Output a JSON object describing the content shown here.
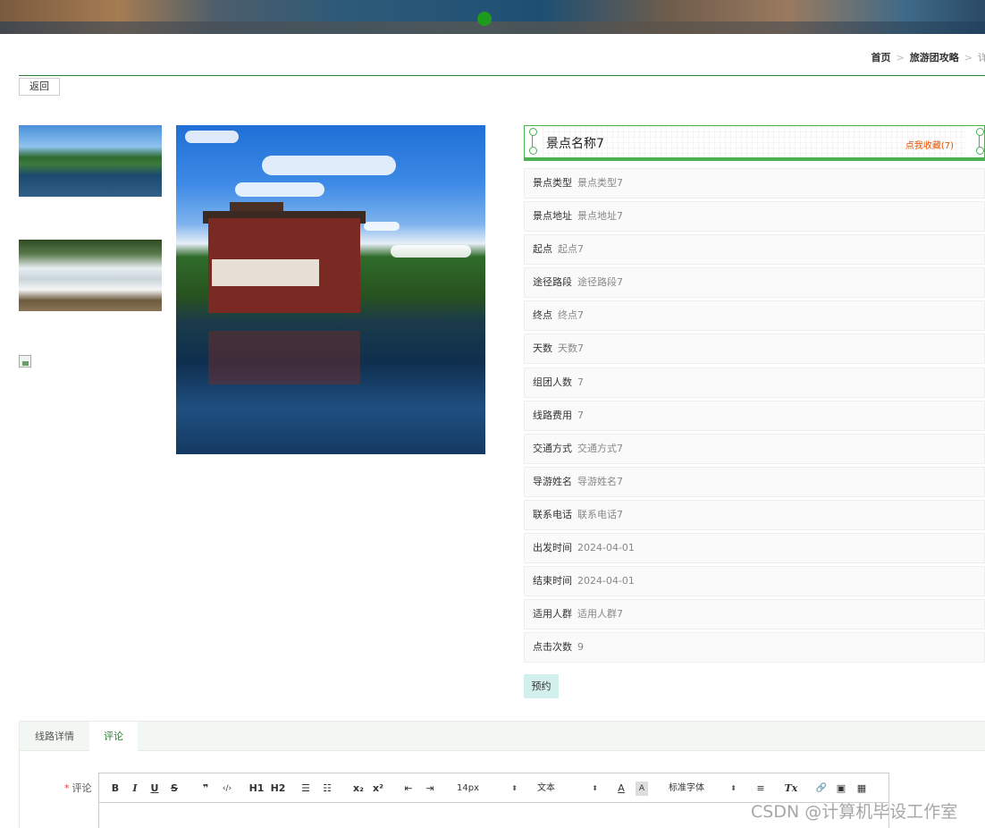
{
  "breadcrumb": {
    "home": "首页",
    "section": "旅游团攻略",
    "current": "详情"
  },
  "back_label": "返回",
  "detail": {
    "title": "景点名称7",
    "favorite": "点我收藏(7)",
    "rows": [
      {
        "k": "景点类型",
        "v": "景点类型7"
      },
      {
        "k": "景点地址",
        "v": "景点地址7"
      },
      {
        "k": "起点",
        "v": "起点7"
      },
      {
        "k": "途径路段",
        "v": "途径路段7"
      },
      {
        "k": "终点",
        "v": "终点7"
      },
      {
        "k": "天数",
        "v": "天数7"
      },
      {
        "k": "组团人数",
        "v": "7"
      },
      {
        "k": "线路费用",
        "v": "7"
      },
      {
        "k": "交通方式",
        "v": "交通方式7"
      },
      {
        "k": "导游姓名",
        "v": "导游姓名7"
      },
      {
        "k": "联系电话",
        "v": "联系电话7"
      },
      {
        "k": "出发时间",
        "v": "2024-04-01"
      },
      {
        "k": "结束时间",
        "v": "2024-04-01"
      },
      {
        "k": "适用人群",
        "v": "适用人群7"
      },
      {
        "k": "点击次数",
        "v": "9"
      }
    ],
    "book_label": "预约"
  },
  "tabs": [
    "线路详情",
    "评论"
  ],
  "comment": {
    "required_mark": "*",
    "label": "评论",
    "toolbar": {
      "bold": "B",
      "italic": "I",
      "underline": "U",
      "strike": "S",
      "quote": "❞",
      "code": "‹/›",
      "h1": "H1",
      "h2": "H2",
      "ol": "☰",
      "ul": "☷",
      "sub": "x₂",
      "sup": "x²",
      "outdent": "⇤",
      "indent": "⇥",
      "size": "14px",
      "type": "文本",
      "color": "A",
      "bg": "A",
      "font": "标准字体",
      "align": "≡",
      "clean": "Tx",
      "link": "🔗",
      "image": "▣",
      "video": "▦"
    }
  },
  "watermark": "CSDN @计算机毕设工作室"
}
